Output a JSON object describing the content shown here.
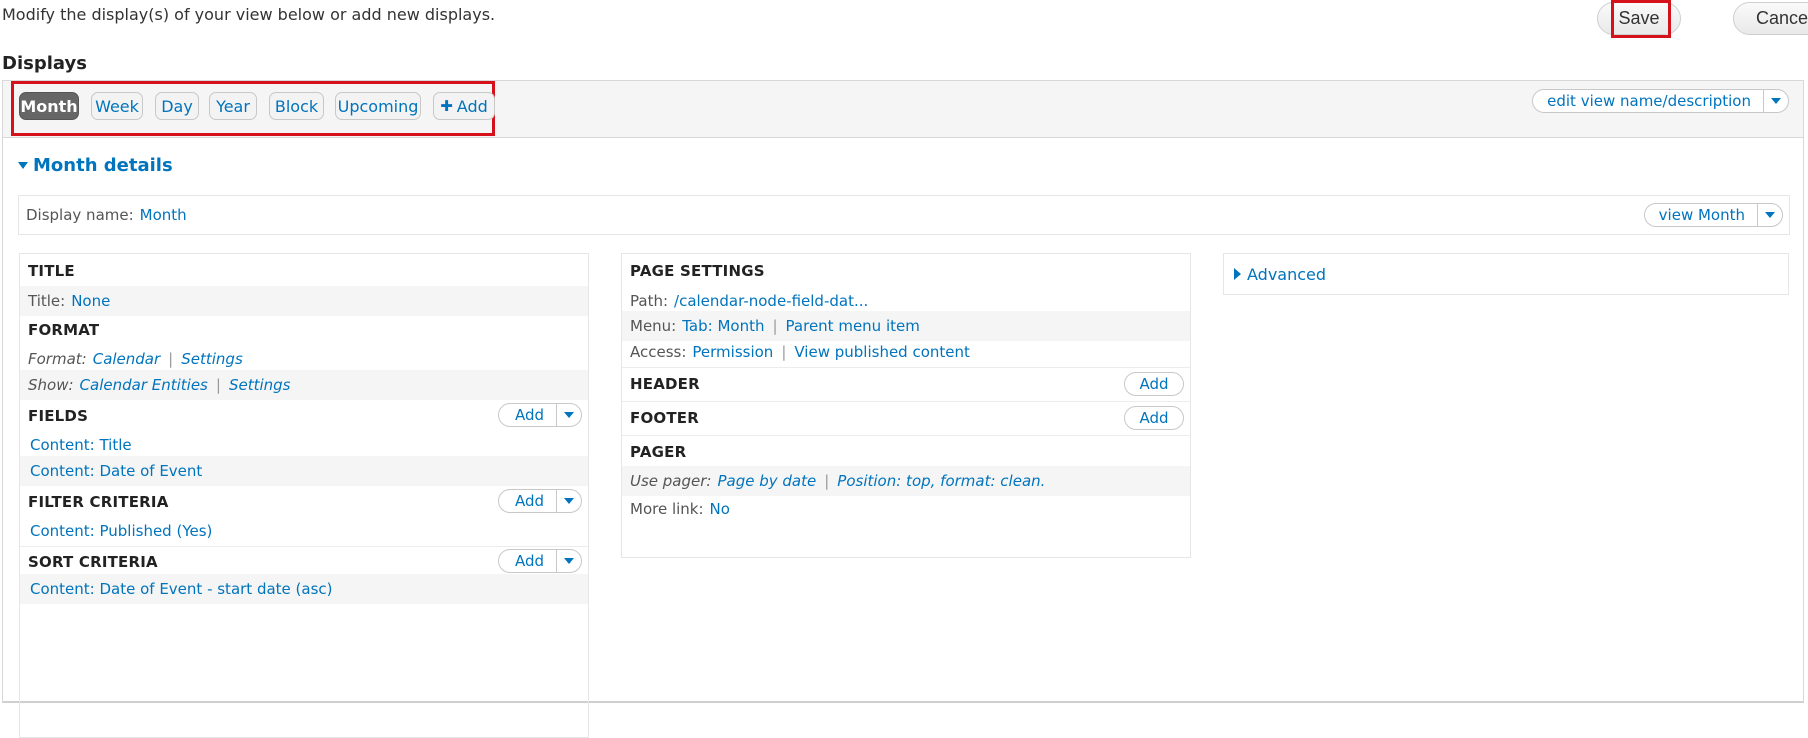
{
  "intro": "Modify the display(s) of your view below or add new displays.",
  "actions": {
    "save": "Save",
    "cancel": "Cancel"
  },
  "displays_title": "Displays",
  "tabs": [
    "Month",
    "Week",
    "Day",
    "Year",
    "Block",
    "Upcoming"
  ],
  "add_tab": "Add",
  "edit_view": "edit view name/description",
  "details_title": "Month details",
  "display_name": {
    "label": "Display name:",
    "value": "Month"
  },
  "view_month": "view Month",
  "col1": {
    "title": {
      "head": "TITLE",
      "label": "Title:",
      "value": "None"
    },
    "format": {
      "head": "FORMAT",
      "label": "Format:",
      "value": "Calendar",
      "settings": "Settings",
      "show_label": "Show:",
      "show_value": "Calendar Entities",
      "show_settings": "Settings"
    },
    "fields": {
      "head": "FIELDS",
      "add": "Add",
      "items": [
        "Content: Title",
        "Content: Date of Event"
      ]
    },
    "filter": {
      "head": "FILTER CRITERIA",
      "add": "Add",
      "items": [
        "Content: Published (Yes)"
      ]
    },
    "sort": {
      "head": "SORT CRITERIA",
      "add": "Add",
      "items": [
        "Content: Date of Event - start date (asc)"
      ]
    }
  },
  "col2": {
    "page_settings": {
      "head": "PAGE SETTINGS",
      "path_label": "Path:",
      "path_value": "/calendar-node-field-dat...",
      "menu_label": "Menu:",
      "menu_value": "Tab: Month",
      "menu_parent": "Parent menu item",
      "access_label": "Access:",
      "access_value": "Permission",
      "access_detail": "View published content"
    },
    "header": {
      "head": "HEADER",
      "add": "Add"
    },
    "footer": {
      "head": "FOOTER",
      "add": "Add"
    },
    "pager": {
      "head": "PAGER",
      "use_label": "Use pager:",
      "use_value": "Page by date",
      "position": "Position: top, format: clean.",
      "more_label": "More link:",
      "more_value": "No"
    }
  },
  "advanced": "Advanced"
}
